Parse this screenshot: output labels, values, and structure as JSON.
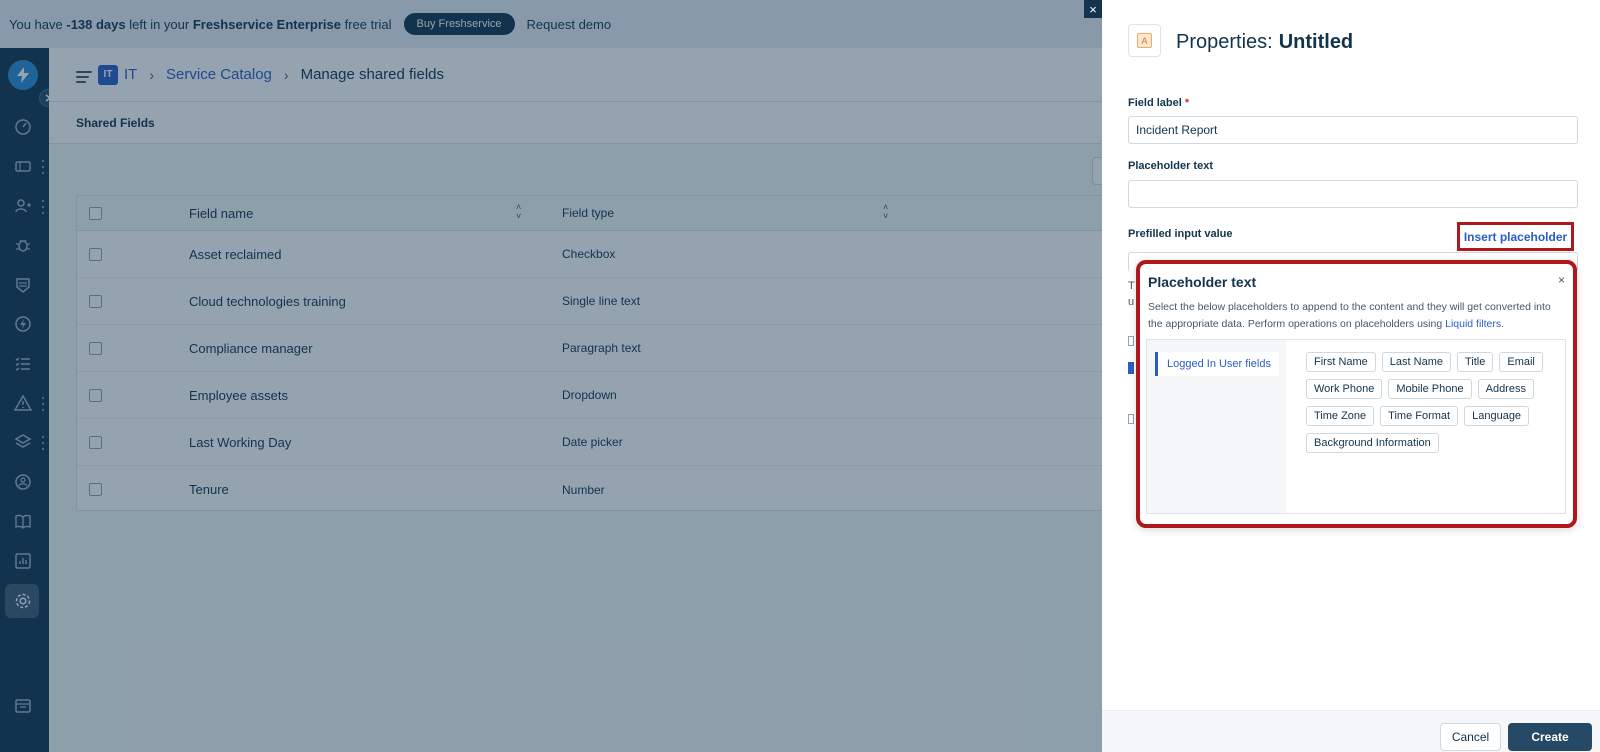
{
  "trial_bar": {
    "prefix": "You have ",
    "days": "-138 days",
    "middle": " left in your ",
    "product": "Freshservice Enterprise",
    "suffix": " free trial",
    "buy_button": "Buy Freshservice",
    "demo_link": "Request demo"
  },
  "header": {
    "workspace_badge": "IT",
    "workspace": "IT",
    "breadcrumb_link": "Service Catalog",
    "breadcrumb_current": "Manage shared fields"
  },
  "subheader": {
    "title": "Shared Fields"
  },
  "table": {
    "columns": [
      "Field name",
      "Field type"
    ],
    "rows": [
      {
        "name": "Asset reclaimed",
        "type": "Checkbox"
      },
      {
        "name": "Cloud technologies training",
        "type": "Single line text"
      },
      {
        "name": "Compliance manager",
        "type": "Paragraph text"
      },
      {
        "name": "Employee assets",
        "type": "Dropdown"
      },
      {
        "name": "Last Working Day",
        "type": "Date picker"
      },
      {
        "name": "Tenure",
        "type": "Number"
      }
    ]
  },
  "panel": {
    "close_icon": "×",
    "icon_letter": "A",
    "title_prefix": "Properties:",
    "title_name": "Untitled",
    "field_label": {
      "label": "Field label",
      "required_mark": "*",
      "value": "Incident Report"
    },
    "placeholder_field": {
      "label": "Placeholder text",
      "value": ""
    },
    "prefilled": {
      "label": "Prefilled input value",
      "insert_link": "Insert placeholder"
    },
    "hidden_text_1": "T",
    "hidden_text_2": "u"
  },
  "popover": {
    "title": "Placeholder text",
    "close": "×",
    "description": "Select the below placeholders to append to the content and they will get converted into the appropriate data. Perform operations on placeholders using ",
    "link": "Liquid filters",
    "description_end": ".",
    "tab": "Logged In User fields",
    "chips": [
      "First Name",
      "Last Name",
      "Title",
      "Email",
      "Work Phone",
      "Mobile Phone",
      "Address",
      "Time Zone",
      "Time Format",
      "Language",
      "Background Information"
    ]
  },
  "footer": {
    "cancel": "Cancel",
    "create": "Create"
  },
  "colors": {
    "primary": "#12344d",
    "link": "#2c5cc5",
    "highlight": "#b0171d"
  }
}
